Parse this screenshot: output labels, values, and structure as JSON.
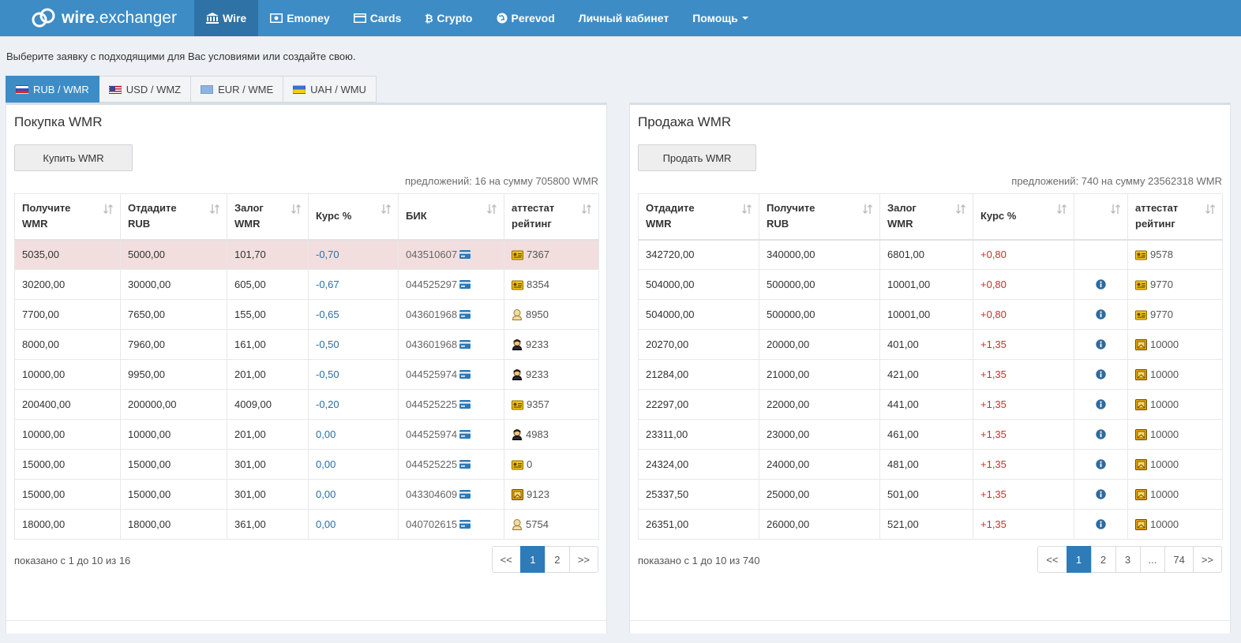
{
  "brand": {
    "bold": "wire",
    "rest": ".exchanger"
  },
  "nav": [
    {
      "label": "Wire",
      "icon": "bank-icon",
      "active": true
    },
    {
      "label": "Emoney",
      "icon": "money-icon"
    },
    {
      "label": "Cards",
      "icon": "credit-card-icon"
    },
    {
      "label": "Crypto",
      "icon": "bitcoin-icon"
    },
    {
      "label": "Perevod",
      "icon": "globe-icon"
    },
    {
      "label": "Личный кабинет"
    },
    {
      "label": "Помощь",
      "dropdown": true
    }
  ],
  "intro": "Выберите заявку с подходящими для Вас условиями или создайте свою.",
  "tabs": [
    {
      "label": "RUB / WMR",
      "flag": "ru",
      "active": true
    },
    {
      "label": "USD / WMZ",
      "flag": "us"
    },
    {
      "label": "EUR / WME",
      "flag": "eu"
    },
    {
      "label": "UAH / WMU",
      "flag": "ua"
    }
  ],
  "buy": {
    "title": "Покупка WMR",
    "button": "Купить WMR",
    "offers": "предложений: 16 на сумму 705800 WMR",
    "columns": [
      [
        "Получите",
        "WMR"
      ],
      [
        "Отдадите",
        "RUB"
      ],
      [
        "Залог",
        "WMR"
      ],
      [
        "Курс %",
        ""
      ],
      [
        "БИК",
        ""
      ],
      [
        "аттестат",
        "рейтинг"
      ]
    ],
    "rows": [
      [
        "5035,00",
        "5000,00",
        "101,70",
        "-0,70",
        "043510607",
        "personal",
        "7367"
      ],
      [
        "30200,00",
        "30000,00",
        "605,00",
        "-0,67",
        "044525297",
        "personal",
        "8354"
      ],
      [
        "7700,00",
        "7650,00",
        "155,00",
        "-0,65",
        "043601968",
        "formal",
        "8950"
      ],
      [
        "8000,00",
        "7960,00",
        "161,00",
        "-0,50",
        "043601968",
        "initial",
        "9233"
      ],
      [
        "10000,00",
        "9950,00",
        "201,00",
        "-0,50",
        "044525974",
        "initial",
        "9233"
      ],
      [
        "200400,00",
        "200000,00",
        "4009,00",
        "-0,20",
        "044525225",
        "personal",
        "9357"
      ],
      [
        "10000,00",
        "10000,00",
        "201,00",
        "0,00",
        "044525974",
        "initial",
        "4983"
      ],
      [
        "15000,00",
        "15000,00",
        "301,00",
        "0,00",
        "044525225",
        "personal",
        "0"
      ],
      [
        "15000,00",
        "15000,00",
        "301,00",
        "0,00",
        "043304609",
        "merchant",
        "9123"
      ],
      [
        "18000,00",
        "18000,00",
        "361,00",
        "0,00",
        "040702615",
        "formal",
        "5754"
      ]
    ],
    "shown": "показано с 1 до 10 из 16",
    "pages": [
      "<<",
      "1",
      "2",
      ">>"
    ]
  },
  "sell": {
    "title": "Продажа WMR",
    "button": "Продать WMR",
    "offers": "предложений: 740 на сумму 23562318 WMR",
    "columns": [
      [
        "Отдадите",
        "WMR"
      ],
      [
        "Получите",
        "RUB"
      ],
      [
        "Залог",
        "WMR"
      ],
      [
        "Курс %",
        ""
      ],
      [
        "",
        ""
      ],
      [
        "аттестат",
        "рейтинг"
      ]
    ],
    "rows": [
      [
        "342720,00",
        "340000,00",
        "6801,00",
        "+0,80",
        false,
        "personal",
        "9578"
      ],
      [
        "504000,00",
        "500000,00",
        "10001,00",
        "+0,80",
        true,
        "personal",
        "9770"
      ],
      [
        "504000,00",
        "500000,00",
        "10001,00",
        "+0,80",
        true,
        "personal",
        "9770"
      ],
      [
        "20270,00",
        "20000,00",
        "401,00",
        "+1,35",
        true,
        "merchant",
        "10000"
      ],
      [
        "21284,00",
        "21000,00",
        "421,00",
        "+1,35",
        true,
        "merchant",
        "10000"
      ],
      [
        "22297,00",
        "22000,00",
        "441,00",
        "+1,35",
        true,
        "merchant",
        "10000"
      ],
      [
        "23311,00",
        "23000,00",
        "461,00",
        "+1,35",
        true,
        "merchant",
        "10000"
      ],
      [
        "24324,00",
        "24000,00",
        "481,00",
        "+1,35",
        true,
        "merchant",
        "10000"
      ],
      [
        "25337,50",
        "25000,00",
        "501,00",
        "+1,35",
        true,
        "merchant",
        "10000"
      ],
      [
        "26351,00",
        "26000,00",
        "521,00",
        "+1,35",
        true,
        "merchant",
        "10000"
      ]
    ],
    "shown": "показано с 1 до 10 из 740",
    "pages": [
      "<<",
      "1",
      "2",
      "3",
      "...",
      "74",
      ">>"
    ]
  },
  "colors": {
    "nav_bg": "#3d8cc6",
    "nav_active": "#2f72a6",
    "highlight_row": "#f2dede",
    "negative": "#2d6da3",
    "positive": "#c9302c"
  }
}
